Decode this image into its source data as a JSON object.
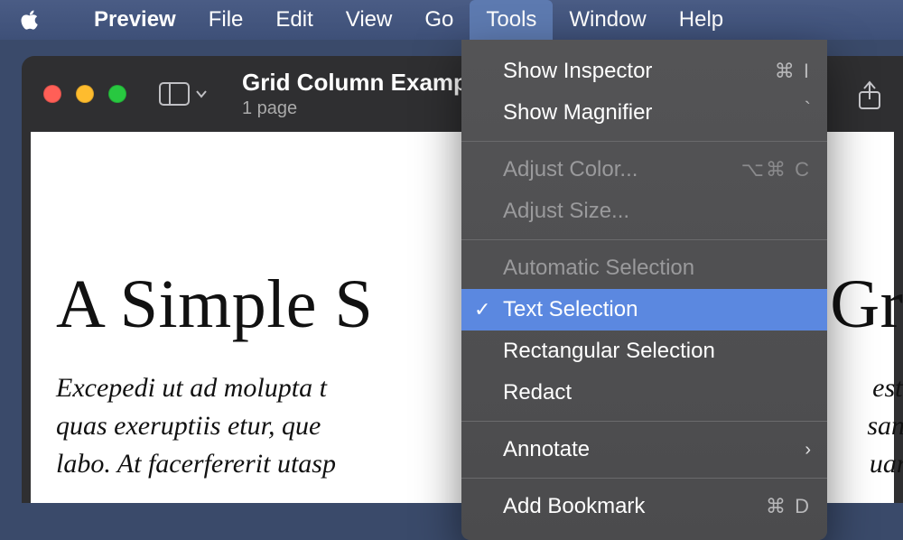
{
  "menubar": {
    "app_name": "Preview",
    "items": [
      "File",
      "Edit",
      "View",
      "Go",
      "Tools",
      "Window",
      "Help"
    ],
    "active": "Tools"
  },
  "window": {
    "title": "Grid Column Exampl",
    "subtitle": "1 page"
  },
  "document": {
    "heading_left": "A Simple S",
    "heading_right": "Gri",
    "para_line1_left": "Excepedi ut ad molupta t",
    "para_line1_right": " est a",
    "para_line2_left": "quas exeruptiis etur, que ",
    "para_line2_right": " sanis",
    "para_line3_left": "labo. At facerfererit utasp",
    "para_line3_right": "uam."
  },
  "dropdown": {
    "items": [
      {
        "label": "Show Inspector",
        "shortcut": "⌘ I",
        "disabled": false
      },
      {
        "label": "Show Magnifier",
        "shortcut": "`",
        "disabled": false
      },
      {
        "sep": true
      },
      {
        "label": "Adjust Color...",
        "shortcut": "⌥⌘ C",
        "disabled": true
      },
      {
        "label": "Adjust Size...",
        "shortcut": "",
        "disabled": true
      },
      {
        "sep": true
      },
      {
        "label": "Automatic Selection",
        "shortcut": "",
        "disabled": true
      },
      {
        "label": "Text Selection",
        "shortcut": "",
        "selected": true,
        "checked": true
      },
      {
        "label": "Rectangular Selection",
        "shortcut": ""
      },
      {
        "label": "Redact",
        "shortcut": ""
      },
      {
        "sep": true
      },
      {
        "label": "Annotate",
        "submenu": true
      },
      {
        "sep": true
      },
      {
        "label": "Add Bookmark",
        "shortcut": "⌘ D"
      }
    ]
  }
}
